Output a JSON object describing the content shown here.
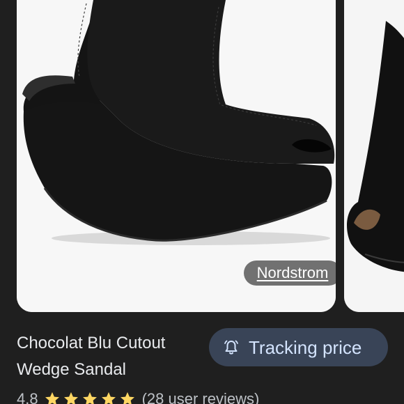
{
  "product": {
    "title": "Chocolat Blu Cutout Wedge Sandal",
    "source": "Nordstrom",
    "rating_value": "4.8",
    "rating_stars": 5,
    "reviews_text": "(28 user reviews)"
  },
  "actions": {
    "track_label": "Tracking price",
    "track_icon": "bell-icon"
  },
  "colors": {
    "background": "#1f1f1f",
    "button_bg": "#394457",
    "button_text": "#d3e3fd",
    "star": "#fdd663"
  }
}
